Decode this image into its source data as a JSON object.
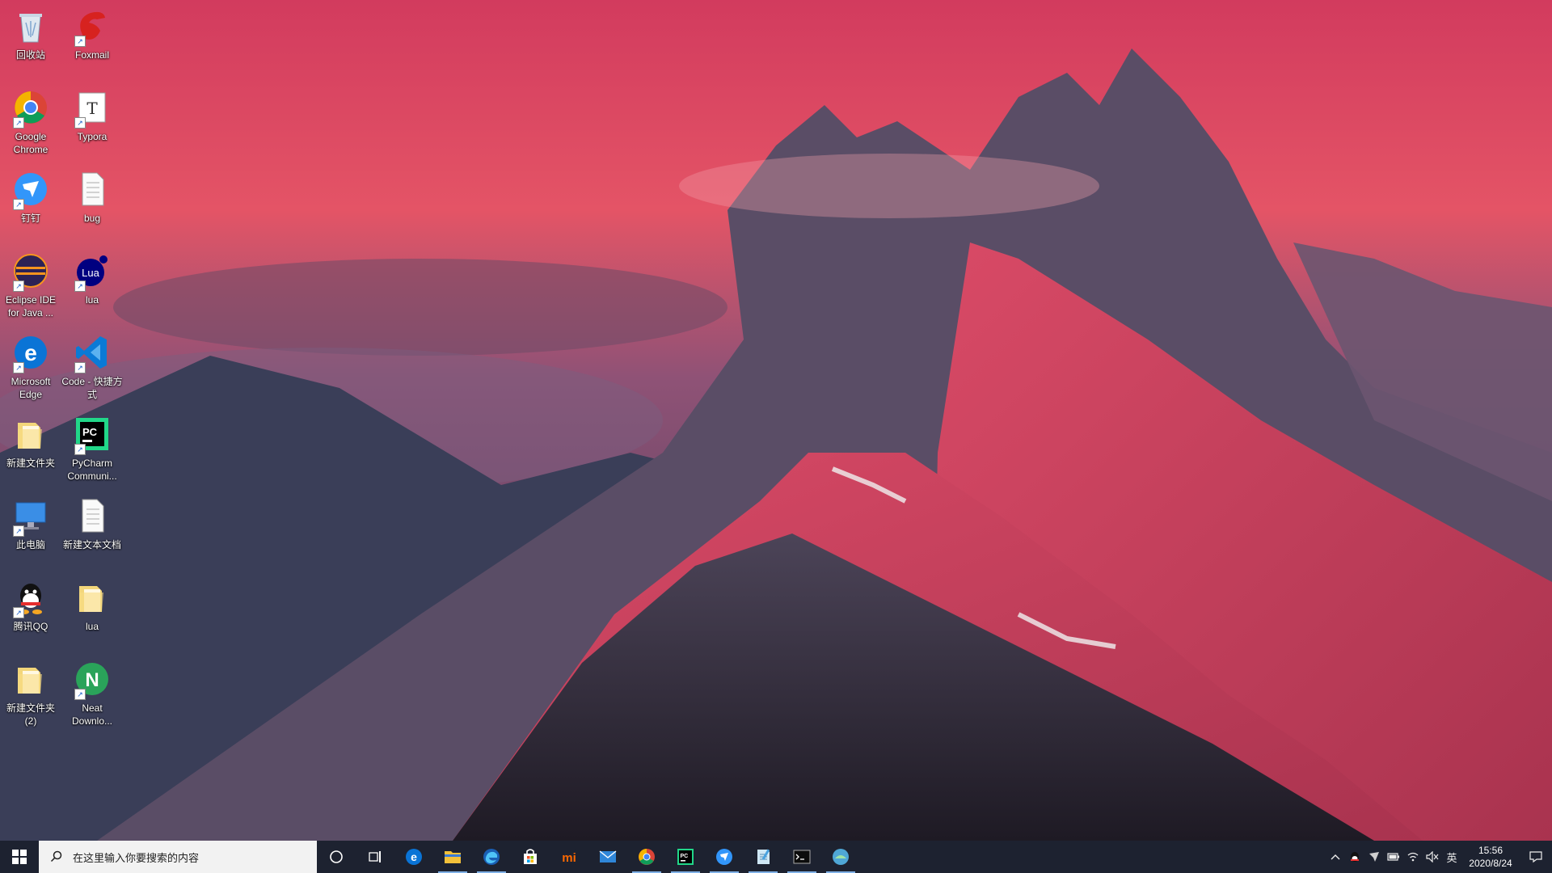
{
  "desktop": {
    "icons": [
      {
        "label": "回收站",
        "icon": "recycle-bin-icon",
        "shortcut": false
      },
      {
        "label": "Foxmail",
        "icon": "foxmail-icon",
        "shortcut": true
      },
      {
        "label": "Google Chrome",
        "icon": "chrome-icon",
        "shortcut": true
      },
      {
        "label": "Typora",
        "icon": "typora-icon",
        "shortcut": true
      },
      {
        "label": "钉钉",
        "icon": "dingtalk-icon",
        "shortcut": true
      },
      {
        "label": "bug",
        "icon": "text-file-icon",
        "shortcut": false
      },
      {
        "label": "Eclipse IDE for Java ...",
        "icon": "eclipse-icon",
        "shortcut": true
      },
      {
        "label": "lua",
        "icon": "lua-icon",
        "shortcut": true
      },
      {
        "label": "Microsoft Edge",
        "icon": "edge-icon",
        "shortcut": true
      },
      {
        "label": "Code - 快捷方式",
        "icon": "vscode-icon",
        "shortcut": true
      },
      {
        "label": "新建文件夹",
        "icon": "folder-icon",
        "shortcut": false
      },
      {
        "label": "PyCharm Communi...",
        "icon": "pycharm-icon",
        "shortcut": true
      },
      {
        "label": "此电脑",
        "icon": "this-pc-icon",
        "shortcut": true
      },
      {
        "label": "新建文本文档",
        "icon": "text-file-icon",
        "shortcut": false
      },
      {
        "label": "腾讯QQ",
        "icon": "qq-icon",
        "shortcut": true
      },
      {
        "label": "lua",
        "icon": "folder-icon",
        "shortcut": false
      },
      {
        "label": "新建文件夹 (2)",
        "icon": "folder-icon",
        "shortcut": false
      },
      {
        "label": "Neat Downlo...",
        "icon": "neat-download-icon",
        "shortcut": true
      }
    ]
  },
  "taskbar": {
    "search_placeholder": "在这里输入你要搜索的内容",
    "pinned": [
      "cortana-icon",
      "task-view-icon",
      "edge-icon",
      "file-explorer-icon",
      "edge-dev-icon",
      "store-icon",
      "mi-icon",
      "mail-icon",
      "chrome-icon",
      "pycharm-icon",
      "dingtalk-icon",
      "notepad-icon",
      "terminal-icon",
      "neat-download-icon"
    ],
    "tray": {
      "ime": "英",
      "time": "15:56",
      "date": "2020/8/24"
    }
  }
}
